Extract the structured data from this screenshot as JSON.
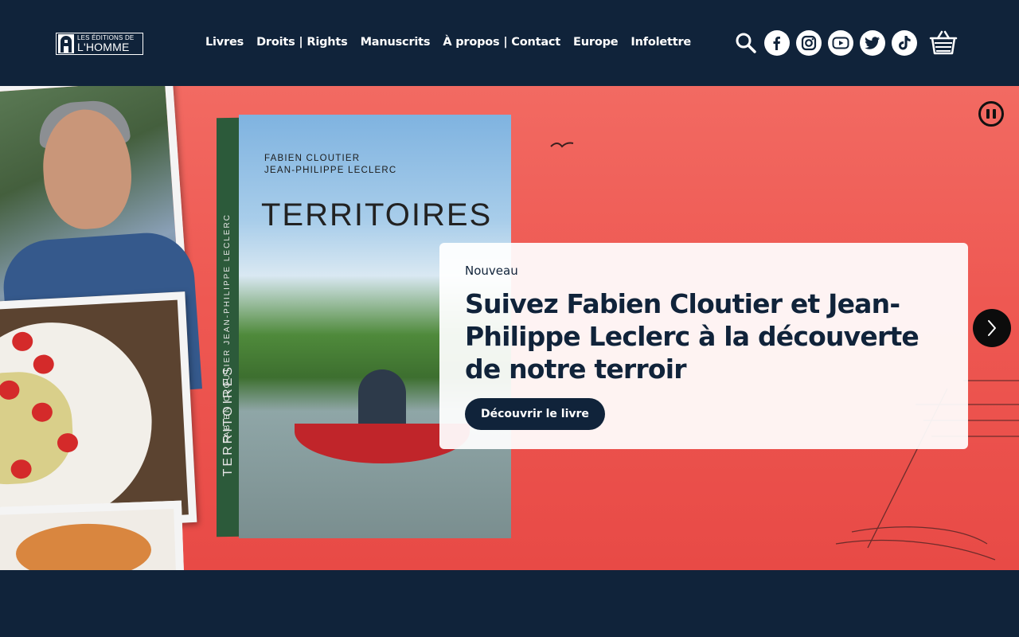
{
  "header": {
    "logo": {
      "top": "LES ÉDITIONS DE",
      "bottom": "L'HOMME"
    },
    "nav": [
      {
        "label": "Livres"
      },
      {
        "label": "Droits | Rights"
      },
      {
        "label": "Manuscrits"
      },
      {
        "label": "À propos | Contact"
      },
      {
        "label": "Europe"
      },
      {
        "label": "Infolettre"
      }
    ],
    "icons": [
      "search-icon",
      "facebook-icon",
      "instagram-icon",
      "youtube-icon",
      "twitter-icon",
      "tiktok-icon",
      "cart-icon"
    ]
  },
  "hero": {
    "book": {
      "authors_line1": "FABIEN CLOUTIER",
      "authors_line2": "JEAN-PHILIPPE LECLERC",
      "title": "TERRITOIRES",
      "spine_authors": "FABIEN CLOUTIER  JEAN-PHILIPPE LECLERC",
      "spine_title": "TERRITOIRES"
    },
    "card": {
      "tag": "Nouveau",
      "title": "Suivez Fabien Cloutier et Jean-Philippe Leclerc à la découverte de notre terroir",
      "button": "Découvrir le livre"
    },
    "controls": [
      "pause-icon",
      "chevron-right-icon"
    ]
  },
  "colors": {
    "navy": "#10233a",
    "hero_red": "#ef5a55",
    "card_bg": "#ffffff"
  }
}
